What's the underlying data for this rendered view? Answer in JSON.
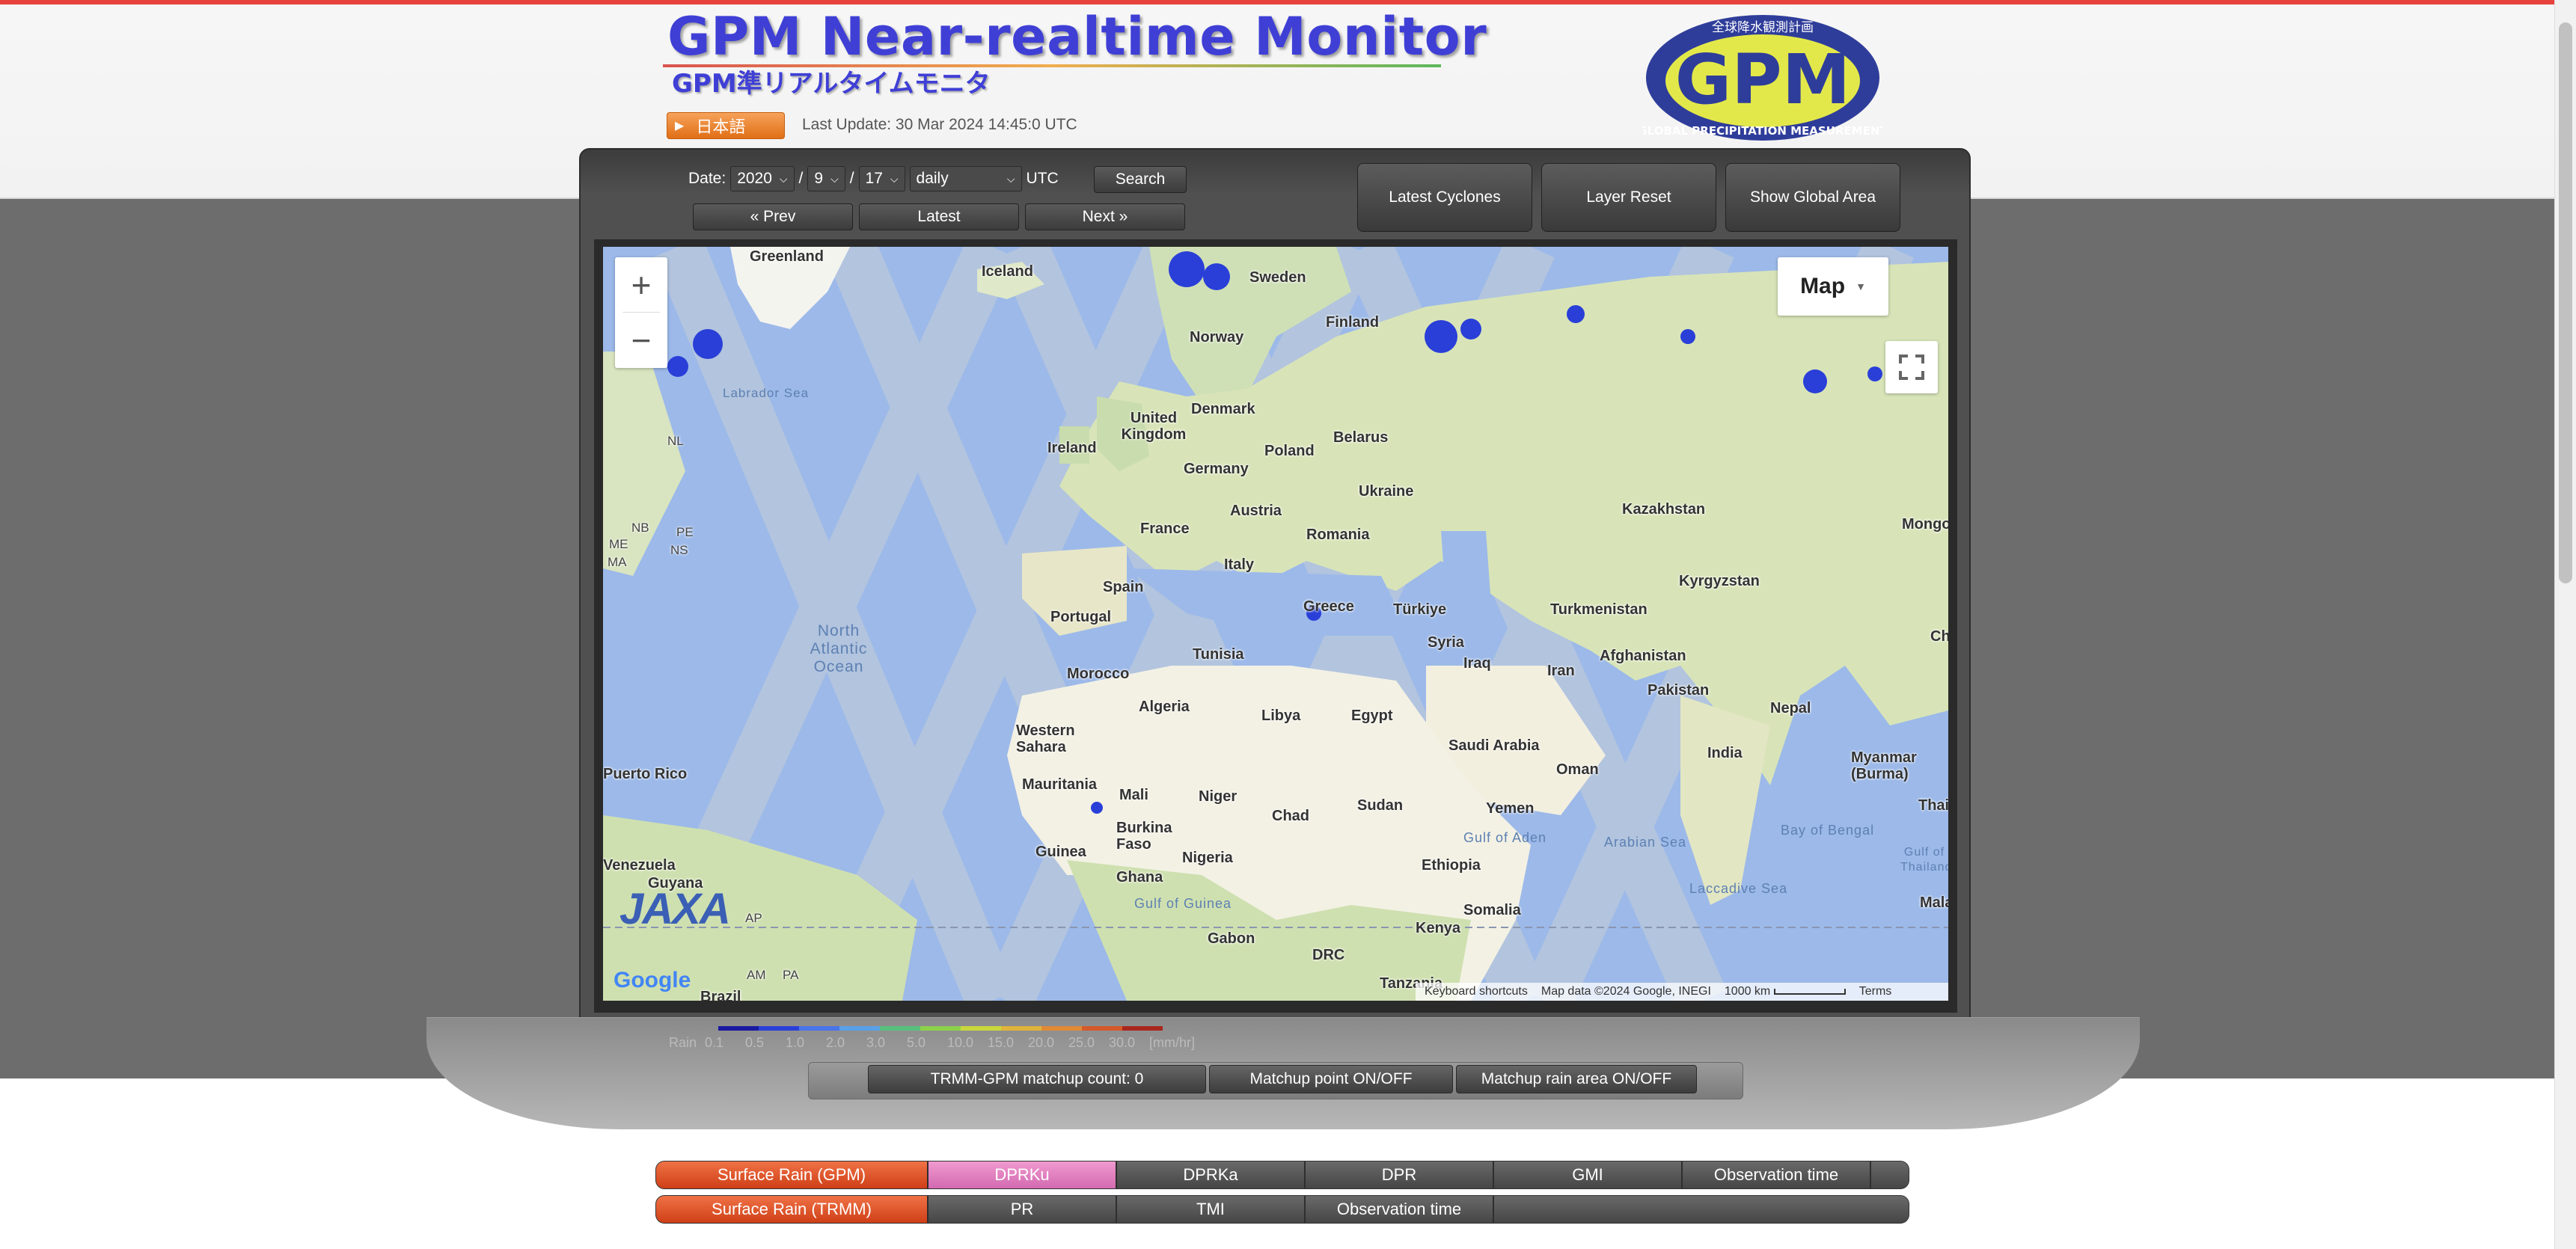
{
  "header": {
    "title": "GPM Near-realtime Monitor",
    "subtitle": "GPM準リアルタイムモニタ",
    "language_button": "日本語",
    "last_update": "Last Update: 30 Mar 2024 14:45:0 UTC",
    "logo_text": "GPM",
    "logo_ring_top": "全球降水観測計画",
    "logo_ring_bottom": "GLOBAL PRECIPITATION MEASUREMENT"
  },
  "controls": {
    "date_label": "Date:",
    "year": "2020",
    "month": "9",
    "day": "17",
    "sep1": "/",
    "sep2": "/",
    "period": "daily",
    "utc_label": "UTC",
    "search_button": "Search",
    "prev_button": "« Prev",
    "latest_button": "Latest",
    "next_button": "Next »",
    "latest_cyclones": "Latest Cyclones",
    "layer_reset": "Layer Reset",
    "show_global_area": "Show Global Area"
  },
  "map": {
    "map_type": "Map",
    "zoom_in": "+",
    "zoom_out": "−",
    "google": "Google",
    "jaxa": "JAXA",
    "attribution": {
      "shortcuts": "Keyboard shortcuts",
      "data": "Map data ©2024 Google, INEGI",
      "scale": "1000 km",
      "terms": "Terms"
    },
    "labels": [
      "Greenland",
      "Iceland",
      "Sweden",
      "Finland",
      "Norway",
      "Labrador Sea",
      "Denmark",
      "United Kingdom",
      "Ireland",
      "Poland",
      "Belarus",
      "Germany",
      "Ukraine",
      "Kazakhstan",
      "Mongo",
      "Austria",
      "France",
      "Romania",
      "Italy",
      "Kyrgyzstan",
      "Spain",
      "Portugal",
      "Greece",
      "Türkiye",
      "Turkmenistan",
      "Syria",
      "Iraq",
      "Iran",
      "Afghanistan",
      "Chin",
      "Tunisia",
      "Morocco",
      "Pakistan",
      "Algeria",
      "Libya",
      "Egypt",
      "Nepal",
      "Western Sahara",
      "Saudi Arabia",
      "Oman",
      "India",
      "Myanmar (Burma)",
      "Puerto Rico",
      "Mauritania",
      "Mali",
      "Niger",
      "Chad",
      "Sudan",
      "Yemen",
      "Thailan",
      "Burkina Faso",
      "Guinea",
      "Nigeria",
      "Ghana",
      "Ethiopia",
      "Venezuela",
      "Guyana",
      "Somalia",
      "Gulf of Guinea",
      "Gulf of Aden",
      "Arabian Sea",
      "Bay of Bengal",
      "Laccadive Sea",
      "Gulf of Thailand",
      "Gabon",
      "Kenya",
      "DRC",
      "Tanzania",
      "Brazil",
      "Mala",
      "North Atlantic Ocean",
      "NL",
      "NB",
      "PE",
      "NS",
      "ME",
      "MA",
      "AP",
      "PA",
      "AM"
    ]
  },
  "legend": {
    "label": "Rain",
    "unit": "[mm/hr]",
    "ticks": [
      "0.1",
      "0.5",
      "1.0",
      "2.0",
      "3.0",
      "5.0",
      "10.0",
      "15.0",
      "20.0",
      "25.0",
      "30.0"
    ],
    "colors": [
      "#1a1aa0",
      "#2a3fd8",
      "#4a74e8",
      "#5aa0e8",
      "#58c07c",
      "#8cd24a",
      "#c8d83c",
      "#e0b43a",
      "#e08a36",
      "#d45a2a",
      "#a8281e"
    ]
  },
  "matchup": {
    "count": "TRMM-GPM matchup count: 0",
    "point_toggle": "Matchup point ON/OFF",
    "rain_area_toggle": "Matchup rain area ON/OFF"
  },
  "tabs_gpm": {
    "head": "Surface Rain (GPM)",
    "items": [
      "DPRKu",
      "DPRKa",
      "DPR",
      "GMI",
      "Observation time"
    ]
  },
  "tabs_trmm": {
    "head": "Surface Rain (TRMM)",
    "items": [
      "PR",
      "TMI",
      "Observation time"
    ]
  }
}
